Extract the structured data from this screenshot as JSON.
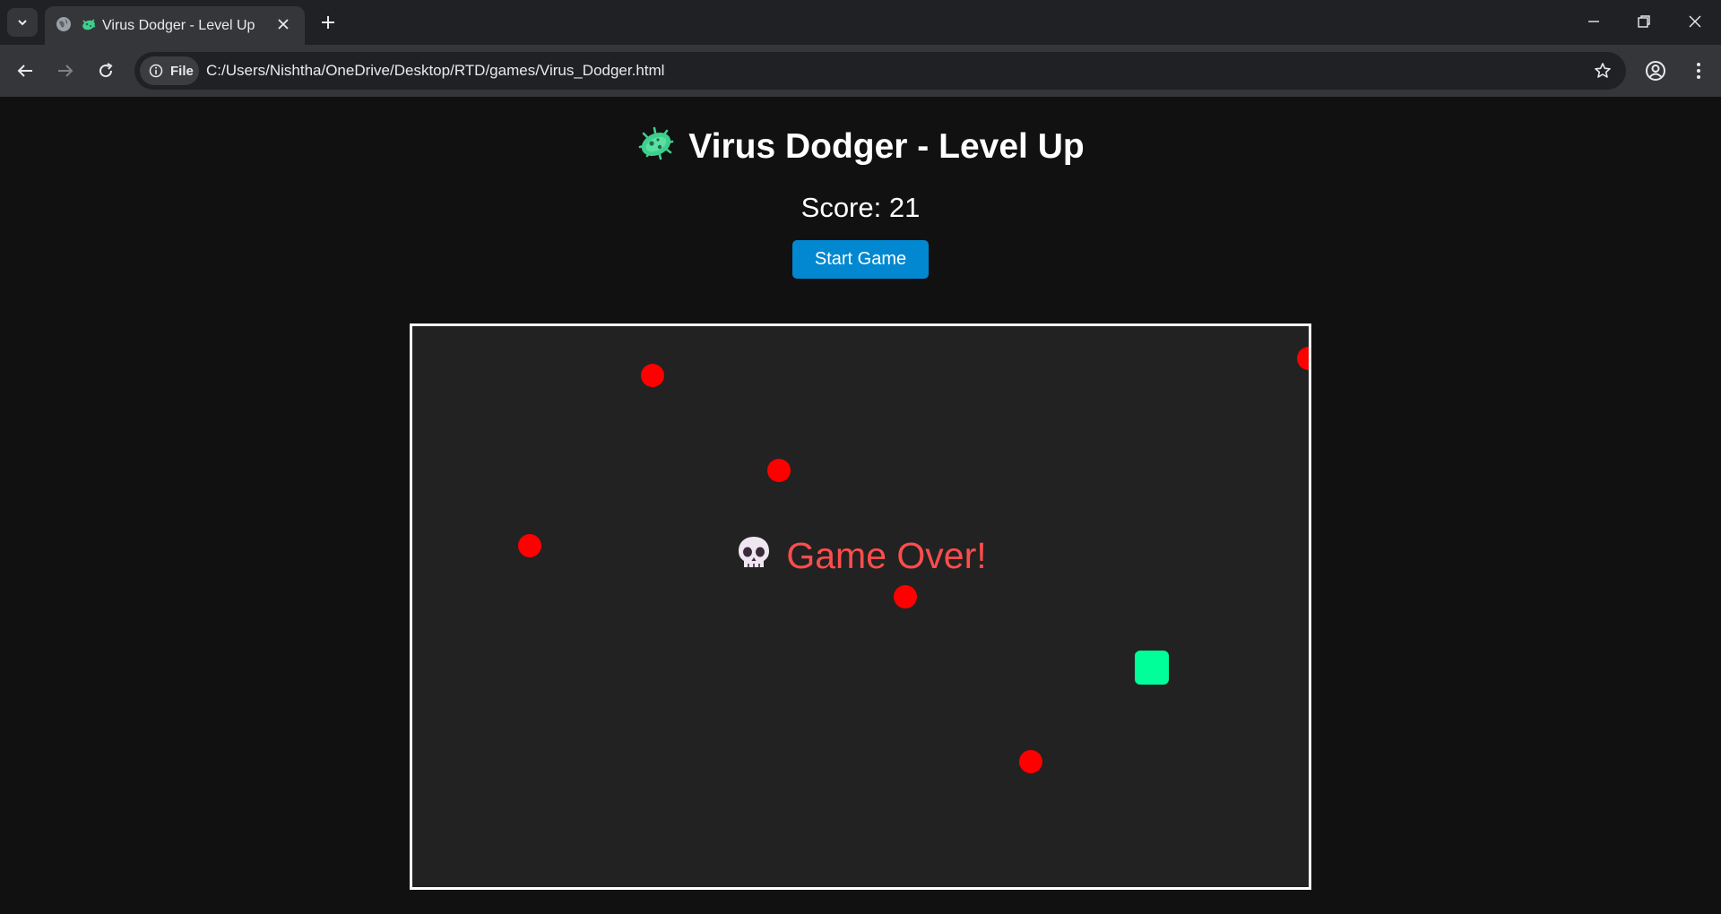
{
  "browser": {
    "tab": {
      "title": "Virus Dodger - Level Up",
      "favicon": "microbe-icon"
    },
    "address_bar": {
      "scheme_chip": "File",
      "url": "C:/Users/Nishtha/OneDrive/Desktop/RTD/games/Virus_Dodger.html"
    },
    "icons": [
      "tab-list-icon",
      "globe-icon",
      "close-icon",
      "new-tab-icon",
      "minimize-icon",
      "restore-icon",
      "window-close-icon",
      "back-icon",
      "forward-icon",
      "reload-icon",
      "info-icon",
      "bookmark-star-icon",
      "profile-icon",
      "menu-icon"
    ]
  },
  "game": {
    "title": "Virus Dodger - Level Up",
    "title_icon": "microbe-icon",
    "score_label": "Score: 21",
    "start_button": "Start Game",
    "game_over_text": "Game Over!",
    "game_over_icon": "skull-icon",
    "colors": {
      "background": "#111111",
      "canvas": "#222222",
      "virus": "#ff0000",
      "player": "#00ff99",
      "game_over": "#ff4d4d",
      "button": "#0288d1"
    }
  }
}
